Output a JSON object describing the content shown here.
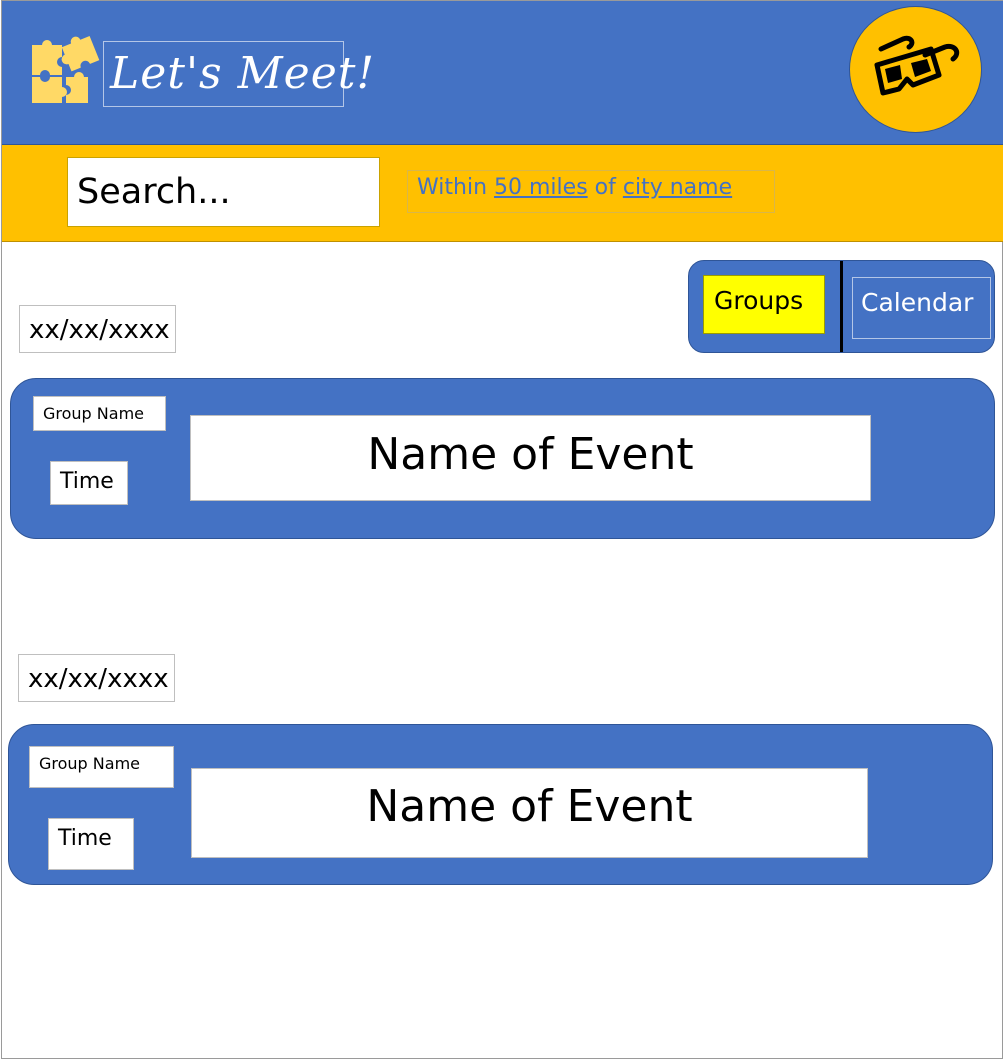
{
  "header": {
    "app_title": "Let's Meet!",
    "logo_icon": "puzzle-icon",
    "avatar_icon": "3d-glasses-icon"
  },
  "search": {
    "placeholder": "Search...",
    "radius_prefix": "Within",
    "radius_value": "50 miles",
    "radius_mid": "of",
    "location": "city name"
  },
  "view_toggle": {
    "groups_label": "Groups",
    "calendar_label": "Calendar",
    "active": "Groups"
  },
  "events": [
    {
      "date": "xx/xx/xxxx",
      "group_name": "Group Name",
      "time": "Time",
      "event_name": "Name of Event"
    },
    {
      "date": "xx/xx/xxxx",
      "group_name": "Group Name",
      "time": "Time",
      "event_name": "Name of Event"
    }
  ],
  "colors": {
    "header_blue": "#4472c4",
    "accent_gold": "#ffc000",
    "active_tab_yellow": "#ffff00",
    "puzzle_yellow": "#ffd966"
  }
}
